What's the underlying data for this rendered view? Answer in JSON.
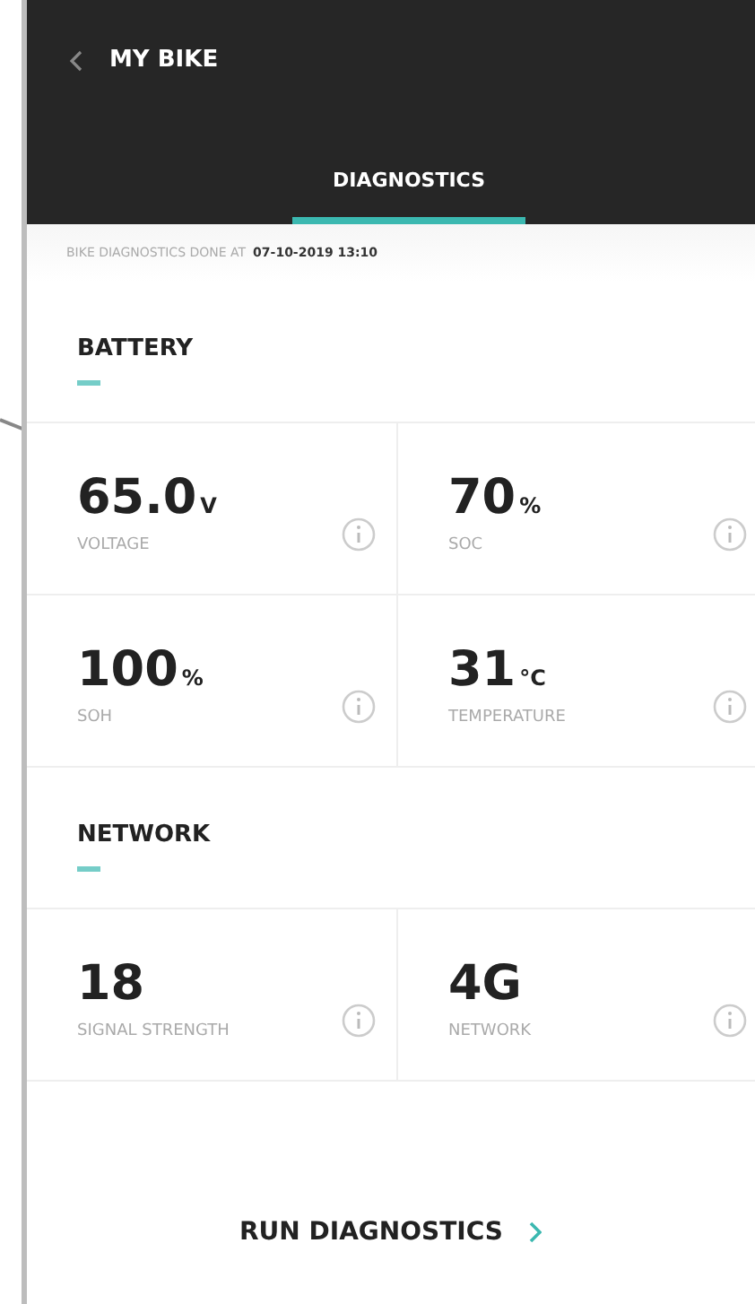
{
  "header": {
    "back_label": "MY BIKE"
  },
  "tabs": [
    {
      "label": "DIAGNOSTICS",
      "selected": true
    }
  ],
  "status": {
    "prefix": "BIKE DIAGNOSTICS DONE AT",
    "timestamp": "07-10-2019 13:10"
  },
  "sections": [
    {
      "title": "BATTERY",
      "metrics": [
        {
          "value": "65.0",
          "unit": "V",
          "label": "VOLTAGE"
        },
        {
          "value": "70",
          "unit": "%",
          "label": "SOC"
        },
        {
          "value": "100",
          "unit": "%",
          "label": "SOH"
        },
        {
          "value": "31",
          "unit": "°C",
          "label": "TEMPERATURE"
        }
      ]
    },
    {
      "title": "NETWORK",
      "metrics": [
        {
          "value": "18",
          "label": "SIGNAL STRENGTH"
        },
        {
          "value": "4G",
          "label": "NETWORK"
        }
      ]
    }
  ],
  "action": {
    "label": "RUN DIAGNOSTICS"
  }
}
